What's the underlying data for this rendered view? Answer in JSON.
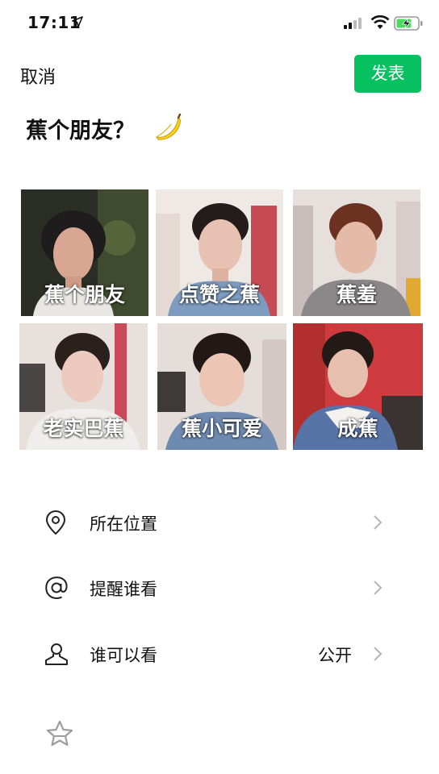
{
  "status_bar": {
    "time": "17:11",
    "icons": [
      "location-arrow-icon",
      "signal-icon",
      "wifi-icon",
      "battery-charging-icon"
    ]
  },
  "header": {
    "cancel_label": "取消",
    "publish_label": "发表",
    "accent_color": "#07c160"
  },
  "post": {
    "text": "蕉个朋友？",
    "emoji": "🍌"
  },
  "photos": [
    {
      "caption": "蕉个朋友"
    },
    {
      "caption": "点赞之蕉"
    },
    {
      "caption": "蕉羞"
    },
    {
      "caption": "老实巴蕉"
    },
    {
      "caption": "蕉小可爱"
    },
    {
      "caption": "成蕉"
    }
  ],
  "options": [
    {
      "icon": "location-pin-icon",
      "label": "所在位置",
      "value": ""
    },
    {
      "icon": "at-sign-icon",
      "label": "提醒谁看",
      "value": ""
    },
    {
      "icon": "person-icon",
      "label": "谁可以看",
      "value": "公开"
    }
  ],
  "footer": {
    "icon": "star-icon"
  }
}
